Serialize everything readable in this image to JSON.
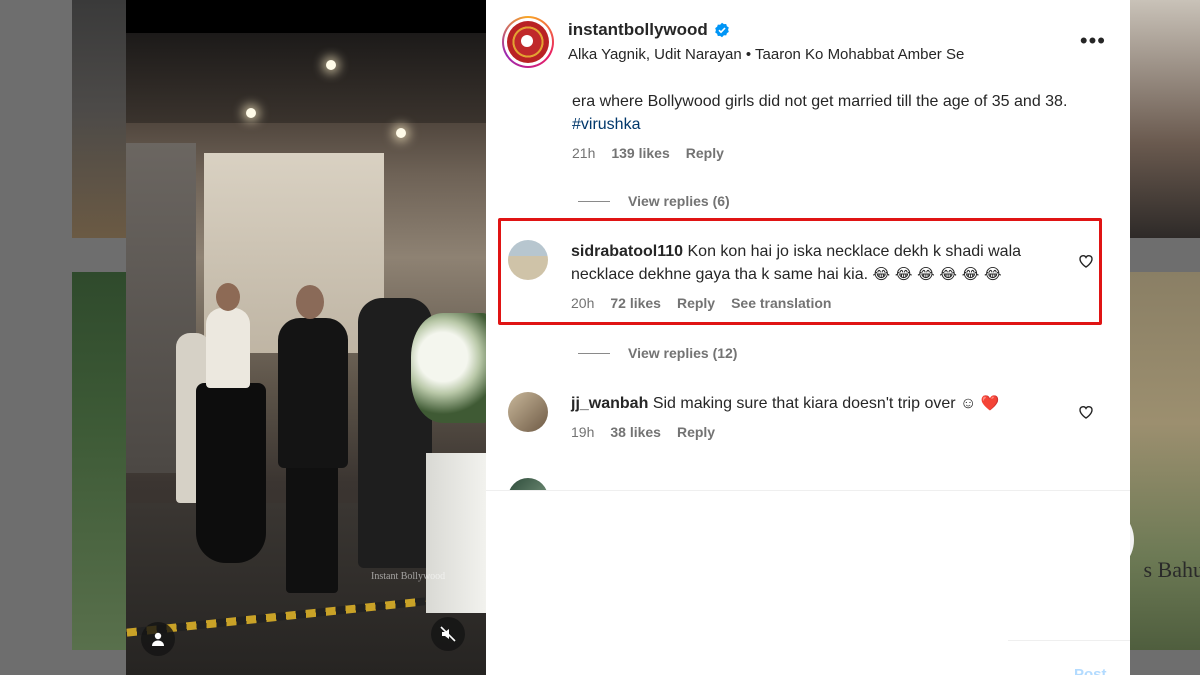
{
  "post": {
    "username": "instantbollywood",
    "audio": "Alka Yagnik, Udit Narayan • Taaron Ko Mohabbat Amber Se",
    "video_watermark": "Instant Bollywood"
  },
  "background": {
    "right_caption": "s Bahu"
  },
  "comments": {
    "c0": {
      "text_plain": "era where Bollywood girls did not get married till the age of 35 and 38.",
      "hashtag": "#virushka",
      "time": "21h",
      "likes": "139 likes",
      "reply": "Reply"
    },
    "view_replies_1": "View replies (6)",
    "c1": {
      "username": "sidrabatool110",
      "text": "Kon kon hai jo iska necklace dekh k shadi wala necklace dekhne gaya tha k same hai kia.",
      "emojis": "😂 😂 😂 😂 😂 😂",
      "time": "20h",
      "likes": "72 likes",
      "reply": "Reply",
      "translation": "See translation"
    },
    "view_replies_2": "View replies (12)",
    "c2": {
      "username": "jj_wanbah",
      "text": "Sid making sure that kiara doesn't trip over ☺",
      "emoji": "❤️",
      "time": "19h",
      "likes": "38 likes",
      "reply": "Reply"
    }
  },
  "footer": {
    "post_label": "Post"
  },
  "colors": {
    "highlight": "#e01414",
    "verified": "#0095f6",
    "link": "#00376b",
    "muted": "#737373"
  }
}
